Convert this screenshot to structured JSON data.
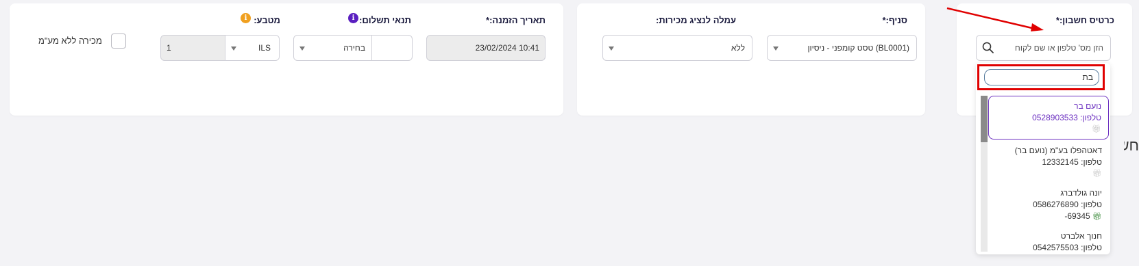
{
  "account_card": {
    "label": "כרטיס חשבון:*",
    "search_placeholder": "הזן מס' טלפון או שם לקוח",
    "search_icon": "search-icon",
    "filter_value": "בת"
  },
  "customer_list": [
    {
      "name": "נועם בר",
      "phone": "טלפון: 0528903533",
      "extra": "",
      "gift_color": "#c8c8c8",
      "selected": true
    },
    {
      "name": "דאטהפלו בע\"מ (נועם בר)",
      "phone": "טלפון: 12332145",
      "extra": "",
      "gift_color": "#c8c8c8",
      "selected": false
    },
    {
      "name": "יונה גולדברג",
      "phone": "טלפון: 0586276890",
      "extra": "69345-",
      "gift_color": "#3a8a3a",
      "selected": false
    },
    {
      "name": "חנוך אלברט",
      "phone": "טלפון: 0542575503",
      "extra": "",
      "gift_color": "#c8c8c8",
      "selected": false
    }
  ],
  "branch_card": {
    "branch_label": "סניף:*",
    "branch_value": "טסט קומפני - ניסיון (BL0001)",
    "agent_label": "עמלה לנציג מכירות:",
    "agent_value": "ללא"
  },
  "order_card": {
    "date_label": "תאריך הזמנה:*",
    "date_value": "23/02/2024 10:41",
    "payment_label": "תנאי תשלום:",
    "payment_value": "בחירה",
    "currency_label": "מטבע:",
    "currency_value": "ILS",
    "rate_value": "1",
    "no_vat_label": "מכירה ללא מע\"מ"
  },
  "partial_heading": "חש",
  "colors": {
    "accent_purple": "#6b2fc0",
    "info_orange": "#f0a020",
    "highlight_red": "#e00000"
  }
}
